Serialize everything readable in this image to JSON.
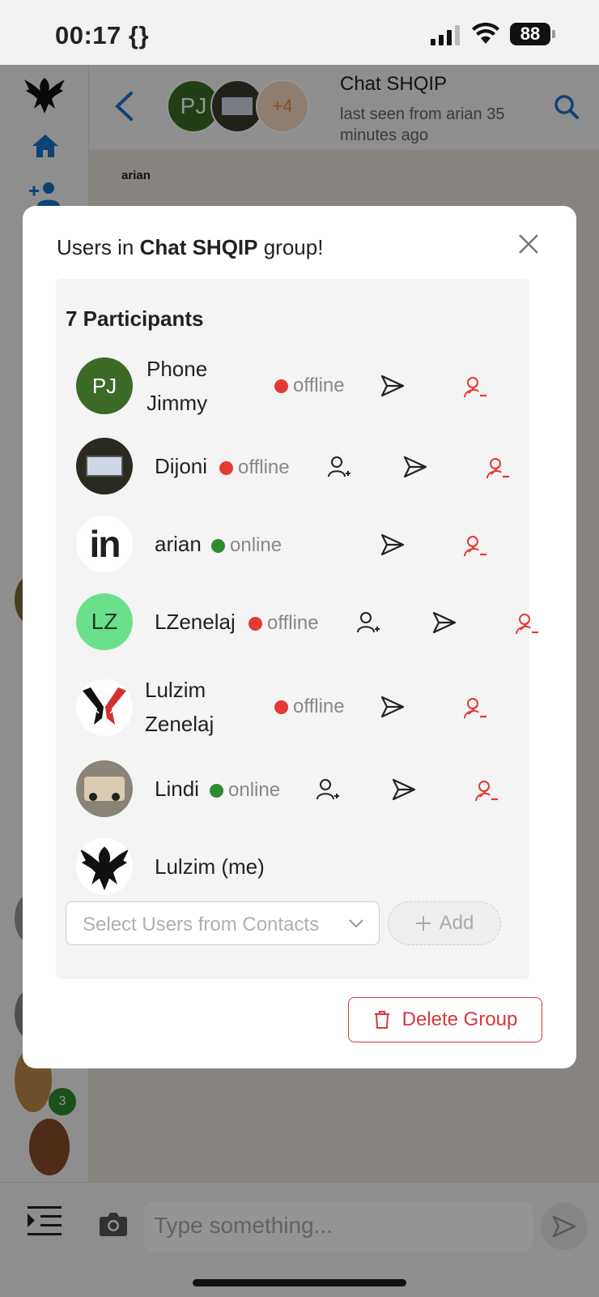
{
  "status_bar": {
    "time": "00:17 {}",
    "battery": "88"
  },
  "header": {
    "group_title": "Chat SHQIP",
    "last_seen": "last seen from arian 35 minutes ago",
    "avatar_initials": "PJ",
    "more_count": "+4"
  },
  "chat": {
    "sender_label": "arian",
    "badge": "3"
  },
  "composer": {
    "placeholder": "Type something..."
  },
  "modal": {
    "title_prefix": "Users in ",
    "title_group": "Chat SHQIP",
    "title_suffix": " group!",
    "participants_count": "7 Participants",
    "participants": [
      {
        "name_line1": "Phone",
        "name_line2": "Jimmy",
        "initials": "PJ",
        "status": "offline",
        "online": false,
        "avatar_color": "#3b6b26"
      },
      {
        "name": "Dijoni",
        "status": "offline",
        "online": false
      },
      {
        "name": "arian",
        "status": "online",
        "online": true
      },
      {
        "name": "LZenelaj",
        "initials": "LZ",
        "status": "offline",
        "online": false,
        "avatar_color": "#6be08a"
      },
      {
        "name_line1": "Lulzim",
        "name_line2": "Zenelaj",
        "status": "offline",
        "online": false
      },
      {
        "name": "Lindi",
        "status": "online",
        "online": true
      },
      {
        "name": "Lulzim (me)"
      }
    ],
    "select_placeholder": "Select Users from Contacts",
    "add_label": "Add",
    "delete_label": "Delete Group"
  },
  "colors": {
    "accent": "#1a73c8",
    "danger": "#d9363e",
    "online": "#2e8b2e",
    "offline": "#e53935"
  }
}
